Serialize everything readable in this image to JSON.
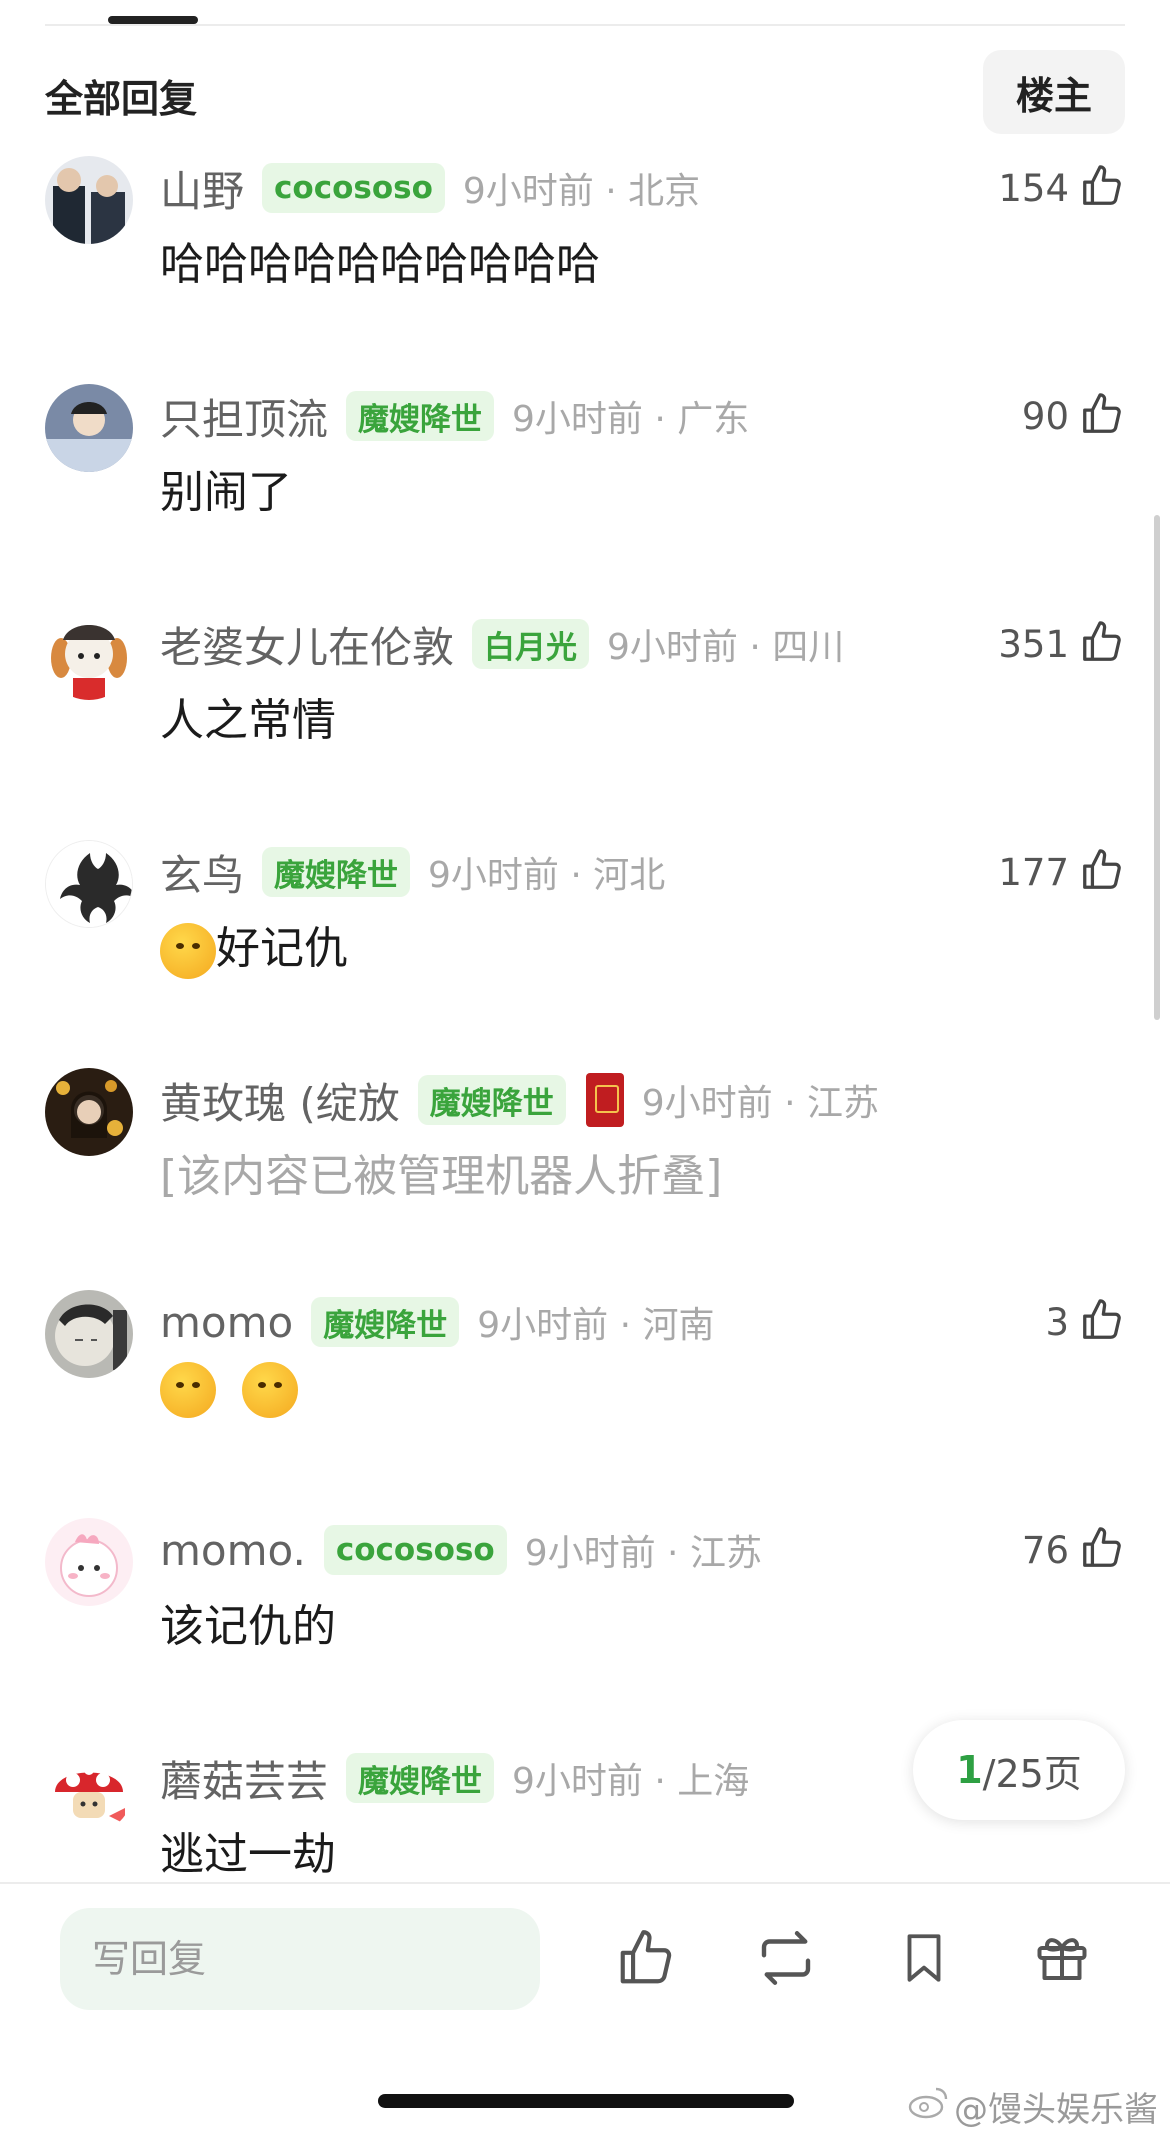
{
  "header": {
    "title": "全部回复",
    "filter_button": "楼主"
  },
  "comments": [
    {
      "user": "山野",
      "badge": "cocososo",
      "time": "9小时前 · 北京",
      "likes": "154",
      "content": "哈哈哈哈哈哈哈哈哈哈",
      "avatar_color": "#2b3442"
    },
    {
      "user": "只担顶流",
      "badge": "魔嫂降世",
      "time": "9小时前 · 广东",
      "likes": "90",
      "content": "别闹了",
      "avatar_color": "#7a8aa6"
    },
    {
      "user": "老婆女儿在伦敦",
      "badge": "白月光",
      "time": "9小时前 · 四川",
      "likes": "351",
      "content": "人之常情",
      "avatar_color": "#e9a35a"
    },
    {
      "user": "玄鸟",
      "badge": "魔嫂降世",
      "time": "9小时前 · 河北",
      "likes": "177",
      "content": "好记仇",
      "avatar_color": "#f4f4f4"
    },
    {
      "user": "黄玫瑰 (绽放",
      "badge": "魔嫂降世",
      "time": "9小时前 · 江苏",
      "likes": "",
      "content": "[该内容已被管理机器人折叠]",
      "avatar_color": "#3a2b1c"
    },
    {
      "user": "momo",
      "badge": "魔嫂降世",
      "time": "9小时前 · 河南",
      "likes": "3",
      "content": "",
      "avatar_color": "#b9b9b4"
    },
    {
      "user": "momo.",
      "badge": "cocososo",
      "time": "9小时前 · 江苏",
      "likes": "76",
      "content": "该记仇的",
      "avatar_color": "#f8dce6"
    },
    {
      "user": "蘑菇芸芸",
      "badge": "魔嫂降世",
      "time": "9小时前 · 上海",
      "likes": "",
      "content": "逃过一劫",
      "avatar_color": "#d8262c"
    }
  ],
  "pager": {
    "current": "1",
    "total": "/25页"
  },
  "bottom_bar": {
    "reply_placeholder": "写回复"
  },
  "watermark": "@馒头娱乐酱",
  "colors": {
    "accent_green": "#2ea043",
    "badge_bg": "#e7f7e5"
  }
}
